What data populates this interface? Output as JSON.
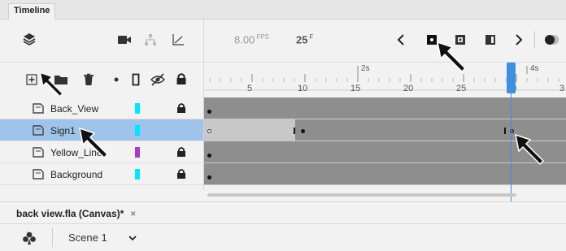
{
  "panel": {
    "tab_label": "Timeline"
  },
  "toolbar": {
    "fps_value": "8.00",
    "fps_unit": "FPS",
    "frame_value": "25",
    "frame_unit": "F",
    "frame_dot": "·"
  },
  "ruler": {
    "seconds": [
      "2s",
      "4s"
    ],
    "frame_numbers": [
      "5",
      "10",
      "15",
      "20",
      "25",
      "30",
      "3"
    ]
  },
  "layers": [
    {
      "name": "Back_View",
      "color": "#00e5ff",
      "locked": true
    },
    {
      "name": "Sign1",
      "color": "#00e5ff",
      "locked": false,
      "selected": true
    },
    {
      "name": "Yellow_Line",
      "color": "#a63cc8",
      "locked": true
    },
    {
      "name": "Background",
      "color": "#00e5ff",
      "locked": true
    }
  ],
  "document": {
    "tab_label": "back view.fla (Canvas)*",
    "close_glyph": "×"
  },
  "scene": {
    "label": "Scene 1"
  },
  "colors": {
    "playhead": "#3f8fe0",
    "selected_row": "#9fc3ea",
    "track": "#8e8e8e",
    "tween": "#c8c8c8"
  }
}
